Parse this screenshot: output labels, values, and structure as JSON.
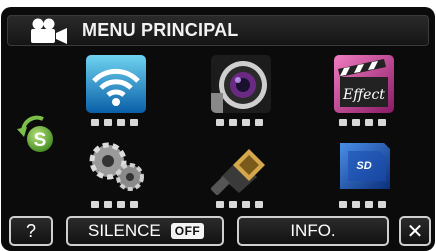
{
  "header": {
    "title": "MENU PRINCIPAL",
    "icon": "video-camera-icon"
  },
  "mode_switch": {
    "label": "S",
    "icon": "mode-switch-icon"
  },
  "tiles": [
    {
      "icon": "wifi-icon"
    },
    {
      "icon": "camera-lens-icon"
    },
    {
      "icon": "effect-clapper-icon",
      "label": "Effect"
    },
    {
      "icon": "gears-icon"
    },
    {
      "icon": "hdmi-connector-icon"
    },
    {
      "icon": "sd-card-icon",
      "label": "SD"
    }
  ],
  "bottom_bar": {
    "help_label": "?",
    "silence_label": "SILENCE",
    "silence_state": "OFF",
    "info_label": "INFO.",
    "close_label": "✕"
  }
}
